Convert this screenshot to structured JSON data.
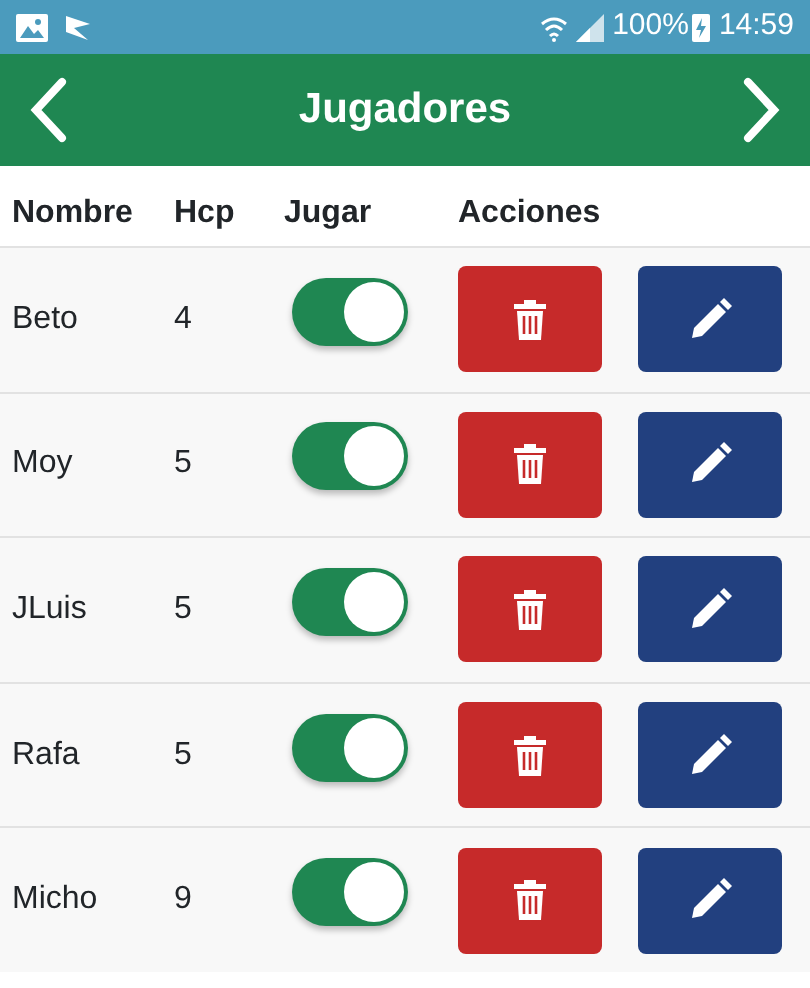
{
  "status_bar": {
    "battery": "100%",
    "time": "14:59"
  },
  "header": {
    "title": "Jugadores"
  },
  "table": {
    "columns": [
      "Nombre",
      "Hcp",
      "Jugar",
      "Acciones"
    ],
    "rows": [
      {
        "name": "Beto",
        "hcp": "4",
        "play": true
      },
      {
        "name": "Moy",
        "hcp": "5",
        "play": true
      },
      {
        "name": "JLuis",
        "hcp": "5",
        "play": true
      },
      {
        "name": "Rafa",
        "hcp": "5",
        "play": true
      },
      {
        "name": "Micho",
        "hcp": "9",
        "play": true
      }
    ]
  }
}
